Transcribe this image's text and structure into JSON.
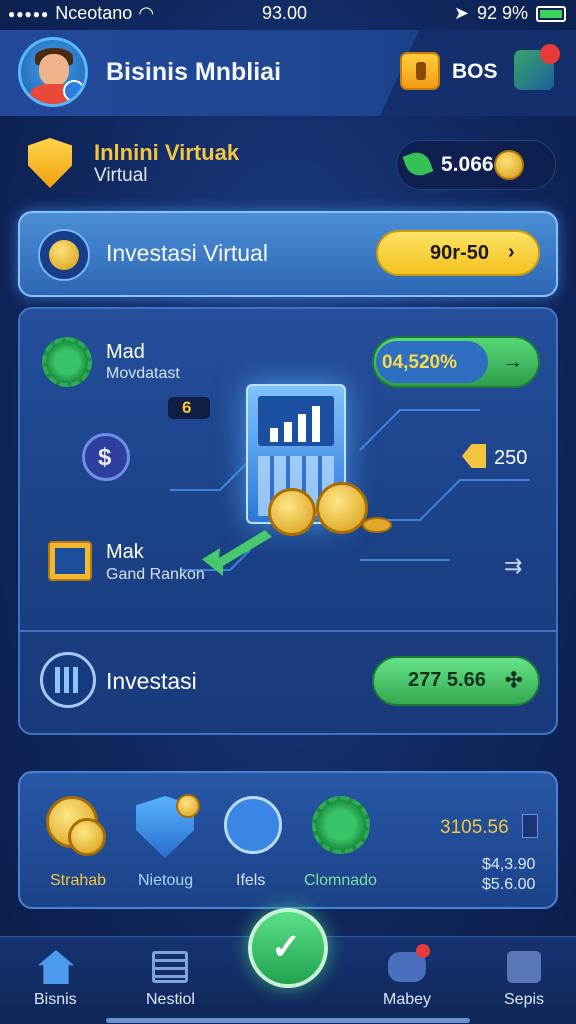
{
  "status_bar": {
    "carrier": "Nceotano",
    "time": "93.00",
    "battery": "92 9%"
  },
  "header": {
    "title": "Bisinis Mnbliai",
    "gift_label": "BOS"
  },
  "row1": {
    "title": "Inlnini Virtuak",
    "subtitle": "Virtual",
    "balance": "5.066"
  },
  "invest_banner": {
    "label": "Investasi Virtual",
    "value": "90r-50",
    "arrow": "›"
  },
  "main": {
    "item1_title": "Mad",
    "item1_sub": "Movdatast",
    "percent": "04,520%",
    "percent_arrow": "→",
    "mini_value": "6",
    "tag_value": "250",
    "item2_title": "Mak",
    "item2_sub": "Gand Rankon",
    "invest_label": "Investasi",
    "invest_value": "277 5.66",
    "invest_arrow": "✣"
  },
  "bottom_card": {
    "labels": [
      "Strahab",
      "Nietoug",
      "Ifels",
      "Clomnado"
    ],
    "total": "3105.56",
    "value1": "$4,3.90",
    "value2": "$5.6.00"
  },
  "nav": {
    "items": [
      "Bisnis",
      "Nestiol",
      "Mabey",
      "Sepis"
    ],
    "center_icon": "check-icon"
  },
  "colors": {
    "accent_gold": "#f3c43f",
    "accent_green": "#47c86d",
    "primary_blue": "#1c4287"
  }
}
